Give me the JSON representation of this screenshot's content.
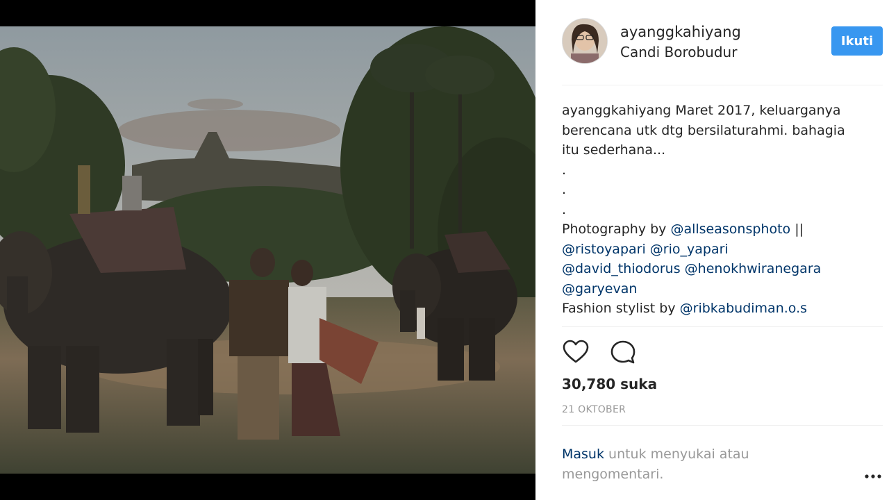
{
  "post": {
    "username": "ayanggkahiyang",
    "location": "Candi Borobudur",
    "follow_label": "Ikuti",
    "caption": {
      "author": "ayanggkahiyang",
      "line1_rest": " Maret 2017, keluarganya",
      "line2": "berencana utk dtg bersilaturahmi. bahagia",
      "line3": "itu sederhana...",
      "dot": ".",
      "photo_prefix": "Photography by ",
      "m_allseasons": "@allseasonsphoto",
      "pipes": " ||",
      "m_ristoyapari": "@ristoyapari",
      "m_rio": "@rio_yapari",
      "m_david": "@david_thiodorus",
      "m_henokh": "@henokhwiranegara",
      "m_garyevan": "@garyevan",
      "fashion_prefix": "Fashion stylist by ",
      "m_ribka": "@ribkabudiman.o.s"
    },
    "likes": "30,780 suka",
    "date": "21 OKTOBER",
    "login_link": "Masuk",
    "login_rest": " untuk menyukai atau mengomentari."
  },
  "icons": {
    "like": "heart-icon",
    "comment": "comment-bubble-icon",
    "more": "more-options-icon"
  },
  "colors": {
    "follow_button": "#3897f0",
    "mention": "#003569",
    "muted": "#999999",
    "background": "#000000"
  }
}
